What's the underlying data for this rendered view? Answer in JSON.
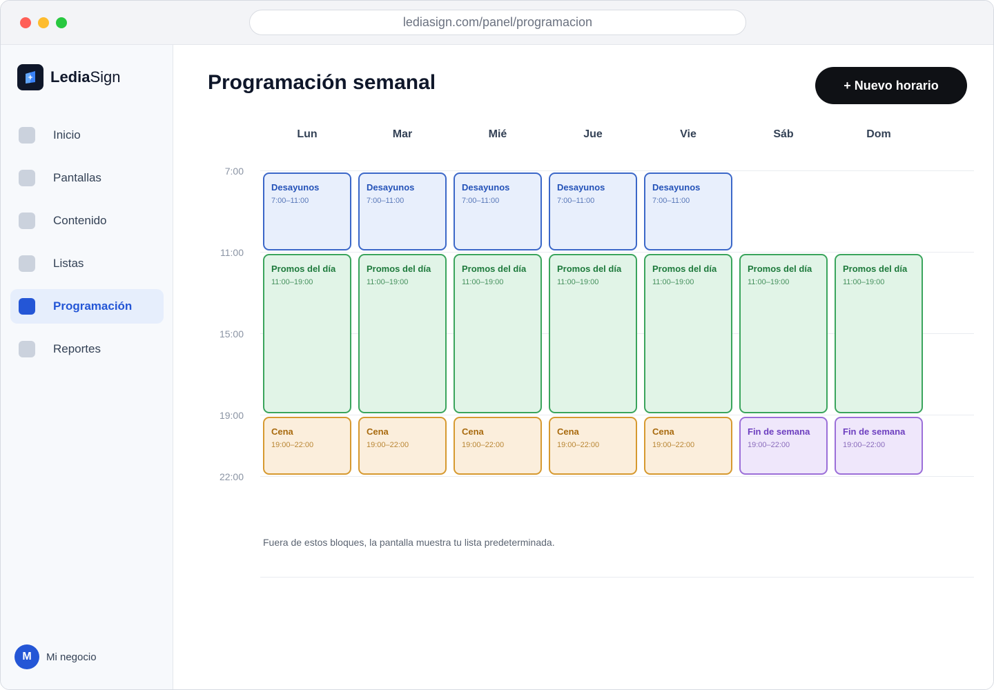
{
  "browser": {
    "url": "lediasign.com/panel/programacion"
  },
  "brand": {
    "name_bold": "Ledia",
    "name_light": "Sign"
  },
  "sidebar": {
    "items": [
      {
        "label": "Inicio",
        "active": false
      },
      {
        "label": "Pantallas",
        "active": false
      },
      {
        "label": "Contenido",
        "active": false
      },
      {
        "label": "Listas",
        "active": false
      },
      {
        "label": "Programación",
        "active": true
      },
      {
        "label": "Reportes",
        "active": false
      }
    ],
    "account": {
      "initial": "M",
      "name": "Mi negocio"
    }
  },
  "header": {
    "title": "Programación semanal",
    "new_button": "+ Nuevo horario"
  },
  "calendar": {
    "days": [
      "Lun",
      "Mar",
      "Mié",
      "Jue",
      "Vie",
      "Sáb",
      "Dom"
    ],
    "time_labels": [
      "7:00",
      "11:00",
      "15:00",
      "19:00",
      "22:00"
    ],
    "blocks": [
      {
        "day": 0,
        "title": "Desayunos",
        "time": "7:00–11:00",
        "start": 7,
        "end": 11,
        "kind": "breakfast"
      },
      {
        "day": 1,
        "title": "Desayunos",
        "time": "7:00–11:00",
        "start": 7,
        "end": 11,
        "kind": "breakfast"
      },
      {
        "day": 2,
        "title": "Desayunos",
        "time": "7:00–11:00",
        "start": 7,
        "end": 11,
        "kind": "breakfast"
      },
      {
        "day": 3,
        "title": "Desayunos",
        "time": "7:00–11:00",
        "start": 7,
        "end": 11,
        "kind": "breakfast"
      },
      {
        "day": 4,
        "title": "Desayunos",
        "time": "7:00–11:00",
        "start": 7,
        "end": 11,
        "kind": "breakfast"
      },
      {
        "day": 0,
        "title": "Promos del día",
        "time": "11:00–19:00",
        "start": 11,
        "end": 19,
        "kind": "promos"
      },
      {
        "day": 1,
        "title": "Promos del día",
        "time": "11:00–19:00",
        "start": 11,
        "end": 19,
        "kind": "promos"
      },
      {
        "day": 2,
        "title": "Promos del día",
        "time": "11:00–19:00",
        "start": 11,
        "end": 19,
        "kind": "promos"
      },
      {
        "day": 3,
        "title": "Promos del día",
        "time": "11:00–19:00",
        "start": 11,
        "end": 19,
        "kind": "promos"
      },
      {
        "day": 4,
        "title": "Promos del día",
        "time": "11:00–19:00",
        "start": 11,
        "end": 19,
        "kind": "promos"
      },
      {
        "day": 5,
        "title": "Promos del día",
        "time": "11:00–19:00",
        "start": 11,
        "end": 19,
        "kind": "promos"
      },
      {
        "day": 6,
        "title": "Promos del día",
        "time": "11:00–19:00",
        "start": 11,
        "end": 19,
        "kind": "promos"
      },
      {
        "day": 0,
        "title": "Cena",
        "time": "19:00–22:00",
        "start": 19,
        "end": 22,
        "kind": "dinner"
      },
      {
        "day": 1,
        "title": "Cena",
        "time": "19:00–22:00",
        "start": 19,
        "end": 22,
        "kind": "dinner"
      },
      {
        "day": 2,
        "title": "Cena",
        "time": "19:00–22:00",
        "start": 19,
        "end": 22,
        "kind": "dinner"
      },
      {
        "day": 3,
        "title": "Cena",
        "time": "19:00–22:00",
        "start": 19,
        "end": 22,
        "kind": "dinner"
      },
      {
        "day": 4,
        "title": "Cena",
        "time": "19:00–22:00",
        "start": 19,
        "end": 22,
        "kind": "dinner"
      },
      {
        "day": 5,
        "title": "Fin de semana",
        "time": "19:00–22:00",
        "start": 19,
        "end": 22,
        "kind": "weekend"
      },
      {
        "day": 6,
        "title": "Fin de semana",
        "time": "19:00–22:00",
        "start": 19,
        "end": 22,
        "kind": "weekend"
      }
    ],
    "footnote": "Fuera de estos bloques, la pantalla muestra tu lista predeterminada."
  },
  "colors": {
    "accent": "#2456d6",
    "breakfast": "#3b67c8",
    "promos": "#3aa45c",
    "dinner": "#d6992f",
    "weekend": "#9b6ed8"
  }
}
